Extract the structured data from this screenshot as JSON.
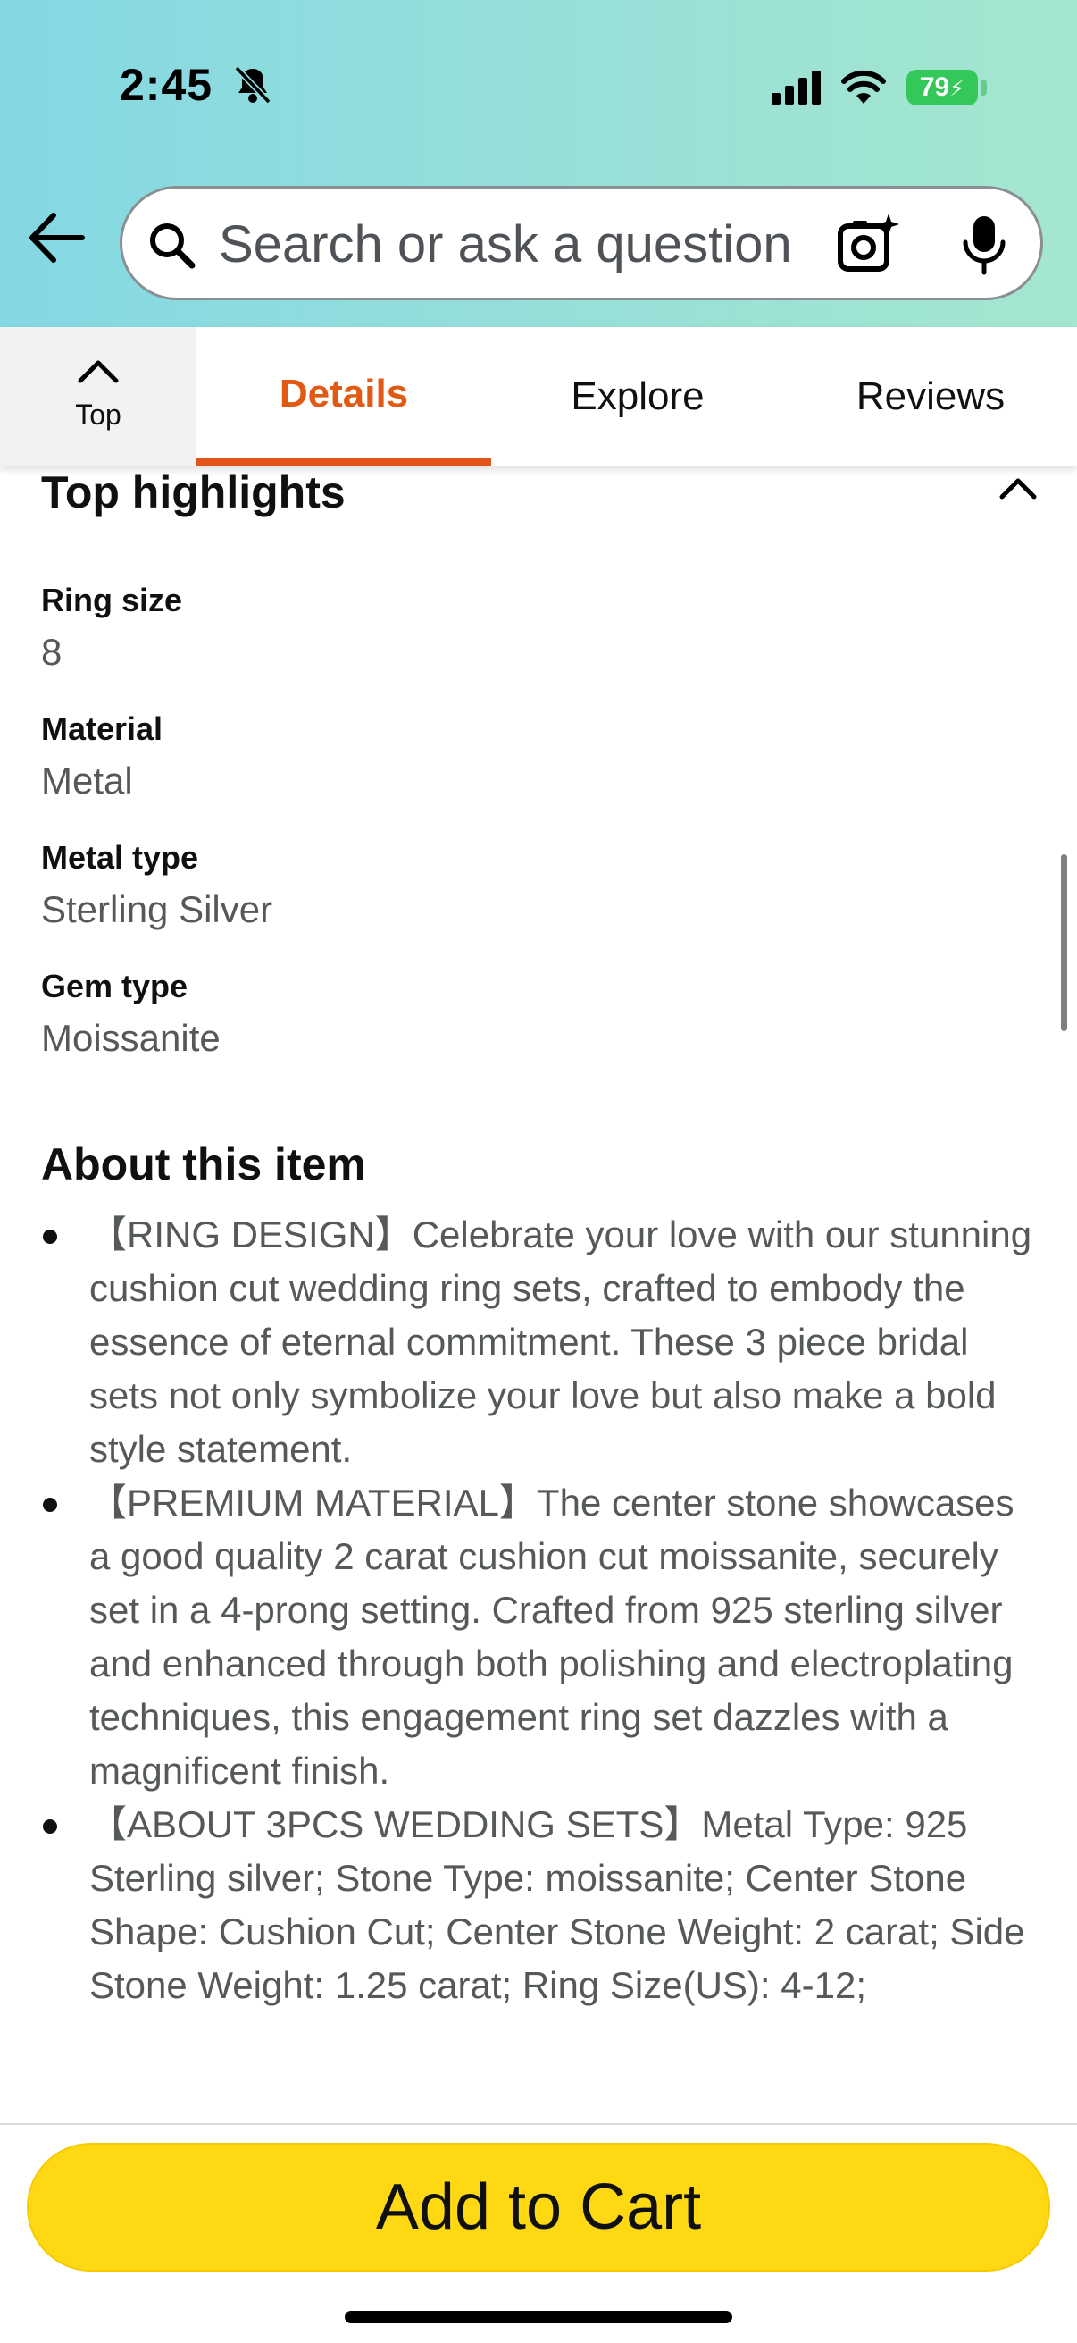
{
  "status_bar": {
    "time": "2:45",
    "battery": "79",
    "icons": [
      "bell-slash-icon",
      "signal-icon",
      "wifi-icon",
      "battery-charging-icon"
    ]
  },
  "search": {
    "placeholder": "Search or ask a question",
    "icons": [
      "back-arrow-icon",
      "search-icon",
      "camera-sparkle-icon",
      "mic-icon"
    ]
  },
  "tabs": {
    "top_label": "Top",
    "items": [
      {
        "label": "Details",
        "active": true
      },
      {
        "label": "Explore",
        "active": false
      },
      {
        "label": "Reviews",
        "active": false
      }
    ],
    "active_color": "#e15a14"
  },
  "highlights": {
    "title": "Top highlights",
    "specs": [
      {
        "label": "Ring size",
        "value": "8"
      },
      {
        "label": "Material",
        "value": "Metal"
      },
      {
        "label": "Metal type",
        "value": "Sterling Silver"
      },
      {
        "label": "Gem type",
        "value": "Moissanite"
      }
    ]
  },
  "about": {
    "title": "About this item",
    "bullets": [
      "【RING DESIGN】Celebrate your love with our stunning cushion cut wedding ring sets, crafted to embody the essence of eternal commitment. These 3 piece bridal sets not only symbolize your love but also make a bold style statement.",
      "【PREMIUM MATERIAL】The center stone showcases a good quality 2 carat cushion cut moissanite, securely set in a 4-prong setting. Crafted from 925 sterling silver and enhanced through both polishing and electroplating techniques, this engagement ring set dazzles with a magnificent finish.",
      "【ABOUT 3PCS WEDDING SETS】Metal Type: 925 Sterling silver; Stone Type: moissanite; Center Stone Shape: Cushion Cut; Center Stone Weight: 2 carat; Side Stone Weight: 1.25 carat; Ring Size(US): 4-12;"
    ]
  },
  "cart": {
    "label": "Add to Cart",
    "color": "#ffd814"
  }
}
